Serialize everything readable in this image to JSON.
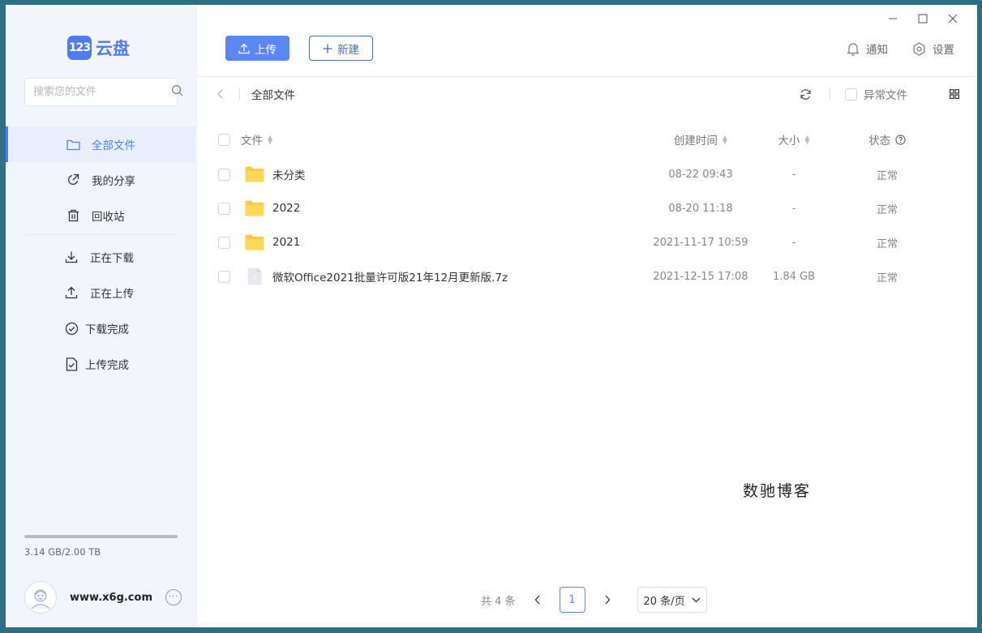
{
  "app": {
    "logo_mark": "123",
    "logo_text": "云盘"
  },
  "sidebar": {
    "search_placeholder": "搜索您的文件",
    "nav_primary": [
      {
        "label": "全部文件",
        "icon": "folder-icon",
        "active": true
      },
      {
        "label": "我的分享",
        "icon": "share-icon",
        "active": false
      },
      {
        "label": "回收站",
        "icon": "trash-icon",
        "active": false
      }
    ],
    "nav_transfer": [
      {
        "label": "正在下载",
        "icon": "download-icon"
      },
      {
        "label": "正在上传",
        "icon": "upload-icon"
      },
      {
        "label": "下载完成",
        "icon": "check-circle-icon"
      },
      {
        "label": "上传完成",
        "icon": "file-check-icon"
      }
    ],
    "storage": {
      "text": "3.14 GB/2.00 TB",
      "used_fraction": 0.0016
    },
    "user": {
      "name": "www.x6g.com"
    }
  },
  "toolbar": {
    "upload_label": "上传",
    "new_label": "新建",
    "notify_label": "通知",
    "settings_label": "设置"
  },
  "path": {
    "crumb": "全部文件",
    "abnormal_label": "异常文件"
  },
  "table": {
    "headers": {
      "name": "文件",
      "time": "创建时间",
      "size": "大小",
      "status": "状态"
    },
    "rows": [
      {
        "name": "未分类",
        "type": "folder",
        "time": "08-22 09:43",
        "size": "-",
        "status": "正常"
      },
      {
        "name": "2022",
        "type": "folder",
        "time": "08-20 11:18",
        "size": "-",
        "status": "正常"
      },
      {
        "name": "2021",
        "type": "folder",
        "time": "2021-11-17 10:59",
        "size": "-",
        "status": "正常"
      },
      {
        "name": "微软Office2021批量许可版21年12月更新版.7z",
        "type": "file",
        "time": "2021-12-15 17:08",
        "size": "1.84 GB",
        "status": "正常"
      }
    ]
  },
  "pagination": {
    "total_label": "共 4 条",
    "current_page": "1",
    "page_size_label": "20 条/页"
  },
  "watermark": "数驰博客",
  "colors": {
    "accent": "#5b86f5",
    "sidebar_bg": "#f2f5fc",
    "folder": "#fcc945"
  }
}
